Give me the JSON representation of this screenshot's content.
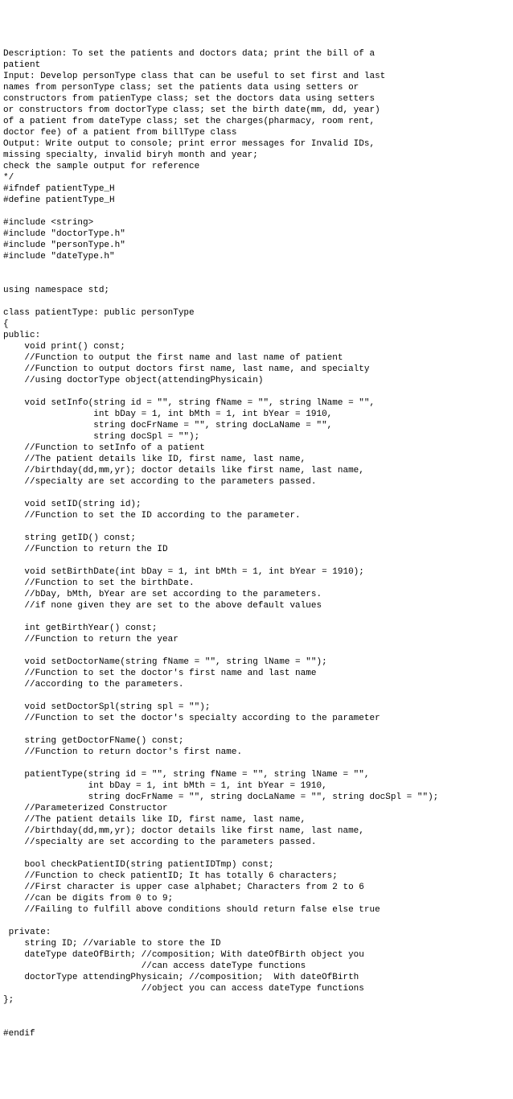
{
  "code": {
    "lines": [
      "Description: To set the patients and doctors data; print the bill of a",
      "patient",
      "Input: Develop personType class that can be useful to set first and last",
      "names from personType class; set the patients data using setters or",
      "constructors from patienType class; set the doctors data using setters",
      "or constructors from doctorType class; set the birth date(mm, dd, year)",
      "of a patient from dateType class; set the charges(pharmacy, room rent,",
      "doctor fee) of a patient from billType class",
      "Output: Write output to console; print error messages for Invalid IDs,",
      "missing specialty, invalid biryh month and year;",
      "check the sample output for reference",
      "*/",
      "#ifndef patientType_H",
      "#define patientType_H",
      "",
      "#include <string>",
      "#include \"doctorType.h\"",
      "#include \"personType.h\"",
      "#include \"dateType.h\"",
      "",
      "",
      "using namespace std;",
      "",
      "class patientType: public personType",
      "{",
      "public:",
      "    void print() const;",
      "    //Function to output the first name and last name of patient",
      "    //Function to output doctors first name, last name, and specialty",
      "    //using doctorType object(attendingPhysicain)",
      "",
      "    void setInfo(string id = \"\", string fName = \"\", string lName = \"\",",
      "                 int bDay = 1, int bMth = 1, int bYear = 1910,",
      "                 string docFrName = \"\", string docLaName = \"\",",
      "                 string docSpl = \"\");",
      "    //Function to setInfo of a patient",
      "    //The patient details like ID, first name, last name,",
      "    //birthday(dd,mm,yr); doctor details like first name, last name,",
      "    //specialty are set according to the parameters passed.",
      "",
      "    void setID(string id);",
      "    //Function to set the ID according to the parameter.",
      "",
      "    string getID() const;",
      "    //Function to return the ID",
      "",
      "    void setBirthDate(int bDay = 1, int bMth = 1, int bYear = 1910);",
      "    //Function to set the birthDate.",
      "    //bDay, bMth, bYear are set according to the parameters.",
      "    //if none given they are set to the above default values",
      "",
      "    int getBirthYear() const;",
      "    //Function to return the year",
      "",
      "    void setDoctorName(string fName = \"\", string lName = \"\");",
      "    //Function to set the doctor's first name and last name",
      "    //according to the parameters.",
      "",
      "    void setDoctorSpl(string spl = \"\");",
      "    //Function to set the doctor's specialty according to the parameter",
      "",
      "    string getDoctorFName() const;",
      "    //Function to return doctor's first name.",
      "",
      "    patientType(string id = \"\", string fName = \"\", string lName = \"\",",
      "                int bDay = 1, int bMth = 1, int bYear = 1910,",
      "                string docFrName = \"\", string docLaName = \"\", string docSpl = \"\");",
      "    //Parameterized Constructor",
      "    //The patient details like ID, first name, last name,",
      "    //birthday(dd,mm,yr); doctor details like first name, last name,",
      "    //specialty are set according to the parameters passed.",
      "",
      "    bool checkPatientID(string patientIDTmp) const;",
      "    //Function to check patientID; It has totally 6 characters;",
      "    //First character is upper case alphabet; Characters from 2 to 6",
      "    //can be digits from 0 to 9;",
      "    //Failing to fulfill above conditions should return false else true",
      "",
      " private:",
      "    string ID; //variable to store the ID",
      "    dateType dateOfBirth; //composition; With dateOfBirth object you",
      "                          //can access dateType functions",
      "    doctorType attendingPhysicain; //composition;  With dateOfBirth",
      "                          //object you can access dateType functions",
      "};",
      "",
      "",
      "#endif"
    ]
  }
}
